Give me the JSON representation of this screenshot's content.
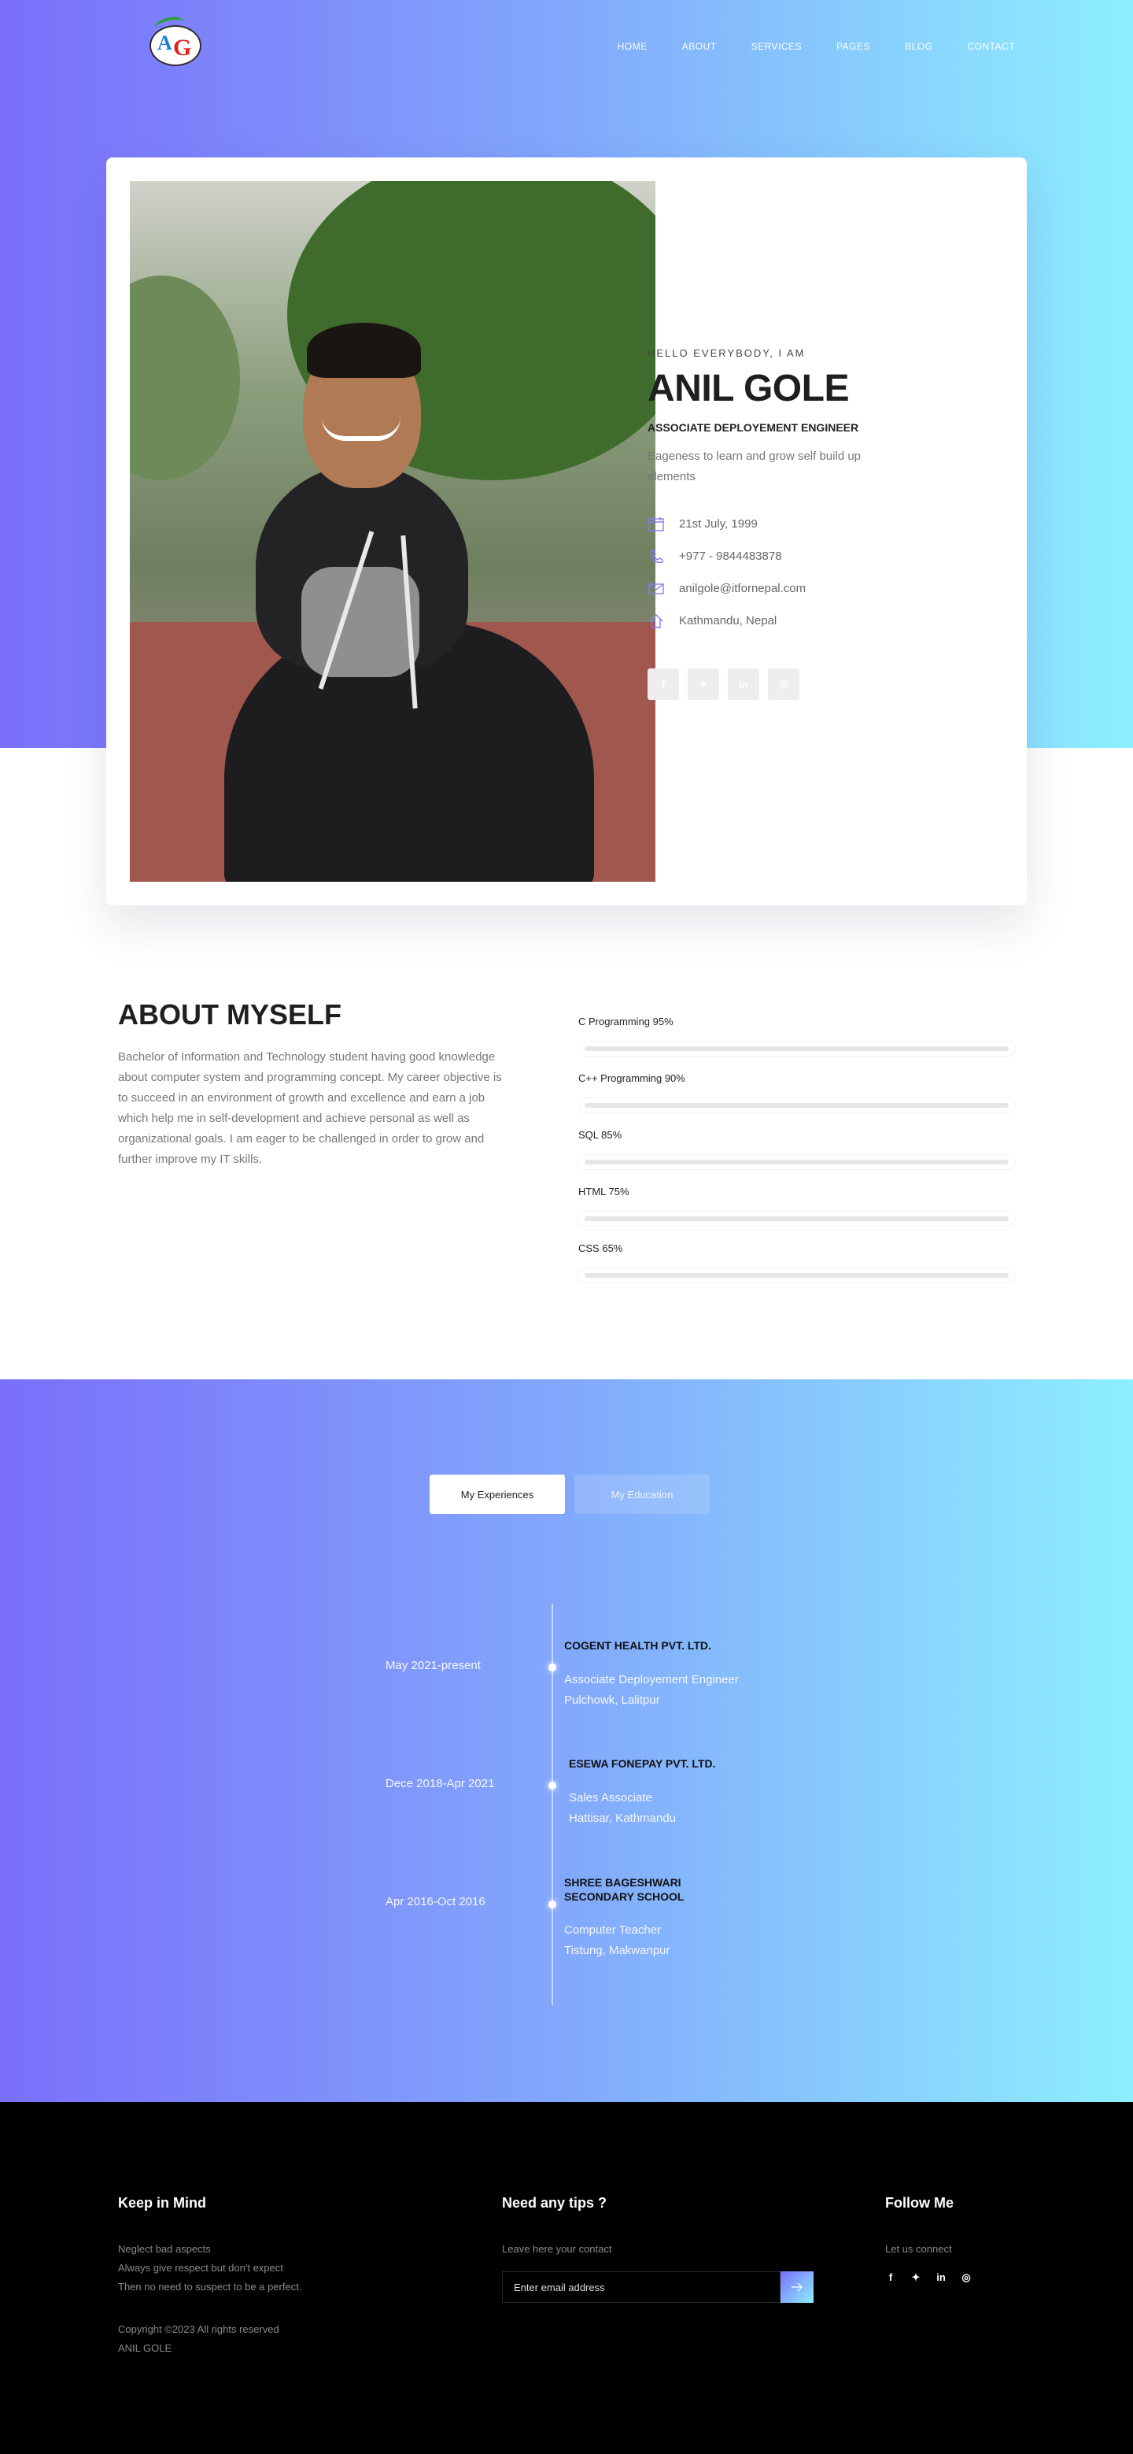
{
  "nav": {
    "links": [
      "HOME",
      "ABOUT",
      "SERVICES",
      "PAGES",
      "BLOG",
      "CONTACT"
    ]
  },
  "hero": {
    "greeting": "HELLO EVERYBODY, I AM",
    "name": "ANIL GOLE",
    "role": "ASSOCIATE DEPLOYEMENT ENGINEER",
    "tagline": "Eageness to learn and grow self build up elements",
    "info": [
      {
        "icon": "calendar-icon",
        "text": "21st July, 1999"
      },
      {
        "icon": "phone-icon",
        "text": "+977 - 9844483878"
      },
      {
        "icon": "mail-icon",
        "text": "anilgole@itfornepal.com"
      },
      {
        "icon": "home-icon",
        "text": "Kathmandu, Nepal"
      }
    ],
    "socials": [
      {
        "icon": "facebook-icon",
        "glyph": "f"
      },
      {
        "icon": "twitter-icon",
        "glyph": "✦"
      },
      {
        "icon": "linkedin-icon",
        "glyph": "in"
      },
      {
        "icon": "instagram-icon",
        "glyph": "◎"
      }
    ]
  },
  "about": {
    "title": "ABOUT MYSELF",
    "text": "Bachelor of Information and Technology student having good knowledge about computer system and programming concept. My career objective is to succeed in an environment of growth and excellence and earn a job which help me in self-development and achieve personal as well as organizational goals. I am eager to be challenged in order to grow and further improve my IT skills."
  },
  "skills": [
    {
      "label": "C Programming 95%",
      "percent": 95
    },
    {
      "label": "C++ Programming 90%",
      "percent": 90
    },
    {
      "label": "SQL 85%",
      "percent": 85
    },
    {
      "label": "HTML 75%",
      "percent": 75
    },
    {
      "label": "CSS 65%",
      "percent": 65
    }
  ],
  "experience": {
    "tabs": [
      "My Experiences",
      "My Education"
    ],
    "items": [
      {
        "date": "May 2021-present",
        "org": "COGENT HEALTH PVT. LTD.",
        "role": "Associate Deployement Engineer",
        "place": "Pulchowk, Lalitpur"
      },
      {
        "date": "Dece 2018-Apr 2021",
        "org": "ESEWA FONEPAY PVT. LTD.",
        "role": "Sales Associate",
        "place": "Hattisar, Kathmandu"
      },
      {
        "date": "Apr 2016-Oct 2016",
        "org": "SHREE BAGESHWARI SECONDARY SCHOOL",
        "role": "Computer Teacher",
        "place": "Tistung, Makwanpur"
      }
    ]
  },
  "footer": {
    "col1": {
      "title": "Keep in Mind",
      "lines": [
        "Neglect bad aspects",
        "Always give respect but don't expect",
        "Then no need to suspect to be a perfect."
      ],
      "copyright": "Copyright ©2023 All rights reserved",
      "owner": "ANIL GOLE"
    },
    "col2": {
      "title": "Need any tips ?",
      "sub": "Leave here your contact",
      "placeholder": "Enter email address"
    },
    "col3": {
      "title": "Follow Me",
      "sub": "Let us connect"
    },
    "socials": [
      {
        "icon": "facebook-icon",
        "glyph": "f"
      },
      {
        "icon": "twitter-icon",
        "glyph": "✦"
      },
      {
        "icon": "linkedin-icon",
        "glyph": "in"
      },
      {
        "icon": "instagram-icon",
        "glyph": "◎"
      }
    ]
  }
}
